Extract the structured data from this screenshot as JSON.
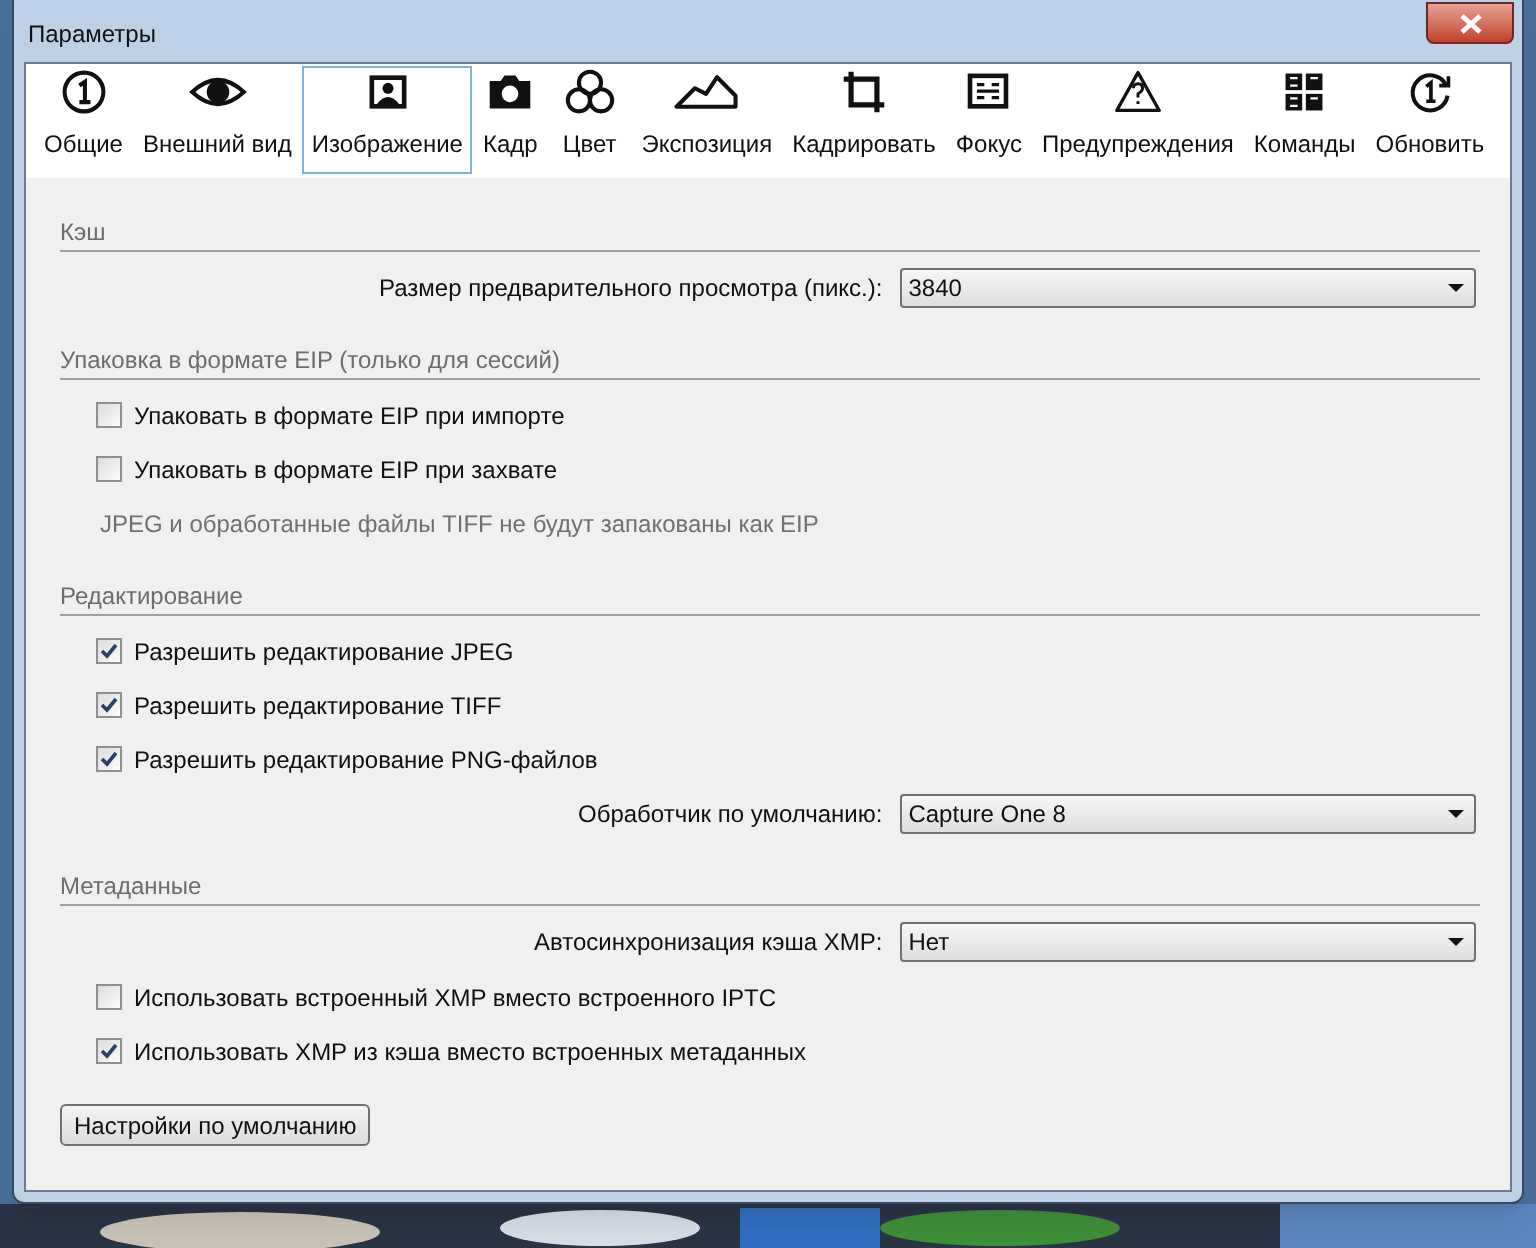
{
  "window": {
    "title": "Параметры"
  },
  "tabs": [
    {
      "label": "Общие",
      "selected": false
    },
    {
      "label": "Внешний вид",
      "selected": false
    },
    {
      "label": "Изображение",
      "selected": true
    },
    {
      "label": "Кадр",
      "selected": false
    },
    {
      "label": "Цвет",
      "selected": false
    },
    {
      "label": "Экспозиция",
      "selected": false
    },
    {
      "label": "Кадрировать",
      "selected": false
    },
    {
      "label": "Фокус",
      "selected": false
    },
    {
      "label": "Предупреждения",
      "selected": false
    },
    {
      "label": "Команды",
      "selected": false
    },
    {
      "label": "Обновить",
      "selected": false
    }
  ],
  "sections": [
    {
      "title": "Кэш",
      "rows": [
        {
          "kind": "dropdown",
          "label": "Размер предварительного просмотра (пикс.):",
          "value": "3840"
        }
      ]
    },
    {
      "title": "Упаковка в формате EIP (только для сессий)",
      "rows": [
        {
          "kind": "checkbox",
          "label": "Упаковать в формате EIP при импорте",
          "checked": false
        },
        {
          "kind": "checkbox",
          "label": "Упаковать в формате EIP при захвате",
          "checked": false
        },
        {
          "kind": "note",
          "label": "JPEG и обработанные файлы TIFF не будут запакованы как EIP"
        }
      ]
    },
    {
      "title": "Редактирование",
      "rows": [
        {
          "kind": "checkbox",
          "label": "Разрешить редактирование JPEG",
          "checked": true
        },
        {
          "kind": "checkbox",
          "label": "Разрешить редактирование TIFF",
          "checked": true
        },
        {
          "kind": "checkbox",
          "label": "Разрешить редактирование PNG-файлов",
          "checked": true
        },
        {
          "kind": "dropdown",
          "label": "Обработчик по умолчанию:",
          "value": "Capture One 8"
        }
      ]
    },
    {
      "title": "Метаданные",
      "rows": [
        {
          "kind": "dropdown",
          "label": "Автосинхронизация кэша XMP:",
          "value": "Нет"
        },
        {
          "kind": "checkbox",
          "label": "Использовать встроенный XMP вместо встроенного IPTC",
          "checked": false
        },
        {
          "kind": "checkbox",
          "label": "Использовать XMP из кэша вместо встроенных метаданных",
          "checked": true
        }
      ]
    }
  ],
  "buttons": [
    "Настройки по умолчанию"
  ]
}
